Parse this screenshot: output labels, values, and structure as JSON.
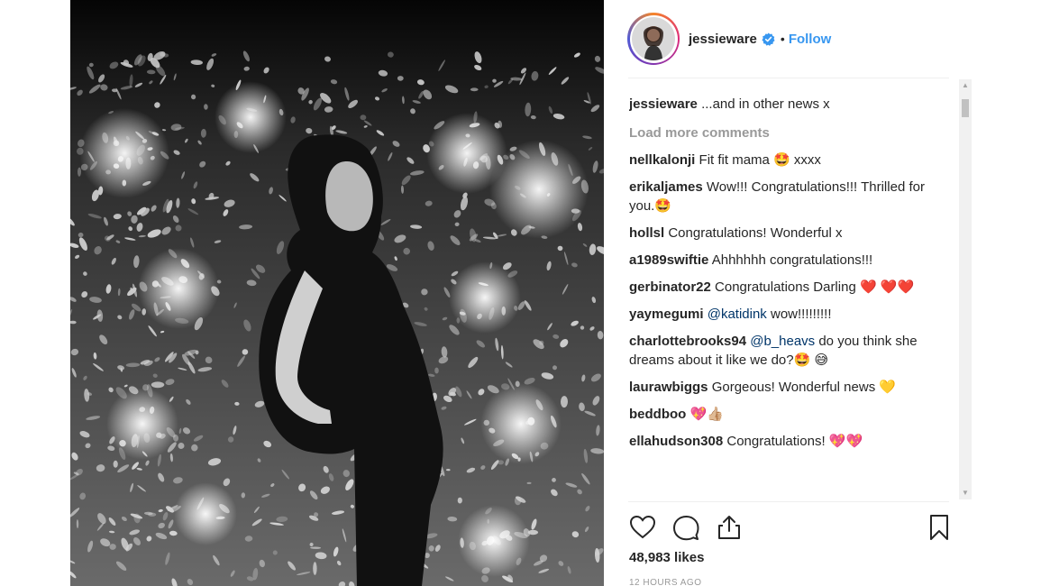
{
  "post": {
    "username": "jessieware",
    "separator": "•",
    "follow_label": "Follow",
    "likes": "48,983 likes",
    "timestamp": "12 HOURS AGO"
  },
  "caption": {
    "username": "jessieware",
    "text": "...and in other news x"
  },
  "load_more_label": "Load more comments",
  "comments": [
    {
      "username": "nellkalonji",
      "text": "Fit fit mama 🤩 xxxx"
    },
    {
      "username": "erikaljames",
      "text": "Wow!!! Congratulations!!! Thrilled for you.🤩"
    },
    {
      "username": "hollsl",
      "text": "Congratulations! Wonderful x"
    },
    {
      "username": "a1989swiftie",
      "text": "Ahhhhhh congratulations!!!"
    },
    {
      "username": "gerbinator22",
      "text": "Congratulations Darling ❤️ ❤️❤️"
    },
    {
      "username": "yaymegumi",
      "mention": "@katidink",
      "text": "wow!!!!!!!!!"
    },
    {
      "username": "charlottebrooks94",
      "mention": "@b_heavs",
      "text": "do you think she dreams about it like we do?🤩 😅"
    },
    {
      "username": "laurawbiggs",
      "text": "Gorgeous! Wonderful news 💛"
    },
    {
      "username": "beddboo",
      "text": "💖👍🏼"
    },
    {
      "username": "ellahudson308",
      "text": "Congratulations! 💖💖"
    }
  ],
  "icons": {
    "like": "heart-icon",
    "comment": "comment-icon",
    "share": "share-icon",
    "save": "bookmark-icon",
    "verified": "verified-badge-icon"
  },
  "colors": {
    "link": "#3897f0",
    "mention": "#003569",
    "muted": "#999999",
    "text": "#262626",
    "verified": "#3897f0"
  }
}
